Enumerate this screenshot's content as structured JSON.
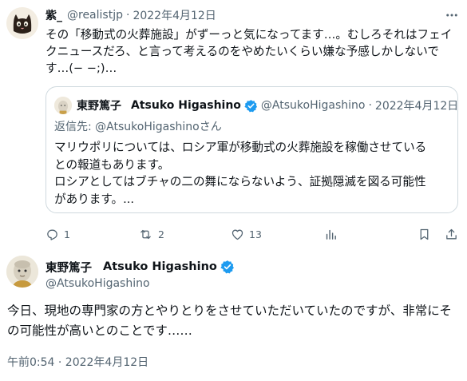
{
  "reply_tweet": {
    "author_name": "紫_",
    "handle": "@realistjp",
    "separator": "·",
    "date": "2022年4月12日",
    "body": "その「移動式の火葬施設」がずーっと気になってます…。むしろそれはフェイクニュースだろ、と言って考えるのをやめたいくらい嫌な予感しかしないです…(− −;)…"
  },
  "quoted_tweet": {
    "author_name_ja": "東野篤子",
    "author_name_en": "Atsuko Higashino",
    "handle": "@AtsukoHigashino",
    "separator": "·",
    "date": "2022年4月12日",
    "reply_to_prefix": "返信先: ",
    "reply_to_handle": "@AtsukoHigashinoさん",
    "body_lines": [
      "マリウポリについては、ロシア軍が移動式の火葬施設を稼働させている",
      "との報道もあります。",
      "ロシアとしてはブチャの二の舞にならないよう、証拠隠滅を図る可能性",
      "があります。..."
    ]
  },
  "actions": {
    "replies": "1",
    "retweets": "2",
    "likes": "13"
  },
  "main_tweet": {
    "author_name_ja": "東野篤子",
    "author_name_en": "Atsuko Higashino",
    "handle": "@AtsukoHigashino",
    "body": "今日、現地の専門家の方とやりとりをさせていただいていたのですが、非常にその可能性が高いとのことです……",
    "timestamp": "午前0:54 · 2022年4月12日"
  },
  "colors": {
    "text": "#0f1419",
    "muted": "#536471",
    "border": "#cfd9de",
    "verified": "#1d9bf0"
  },
  "icons": [
    "more-icon",
    "verified-badge-icon",
    "reply-icon",
    "retweet-icon",
    "like-icon",
    "views-icon",
    "bookmark-icon",
    "share-icon"
  ]
}
